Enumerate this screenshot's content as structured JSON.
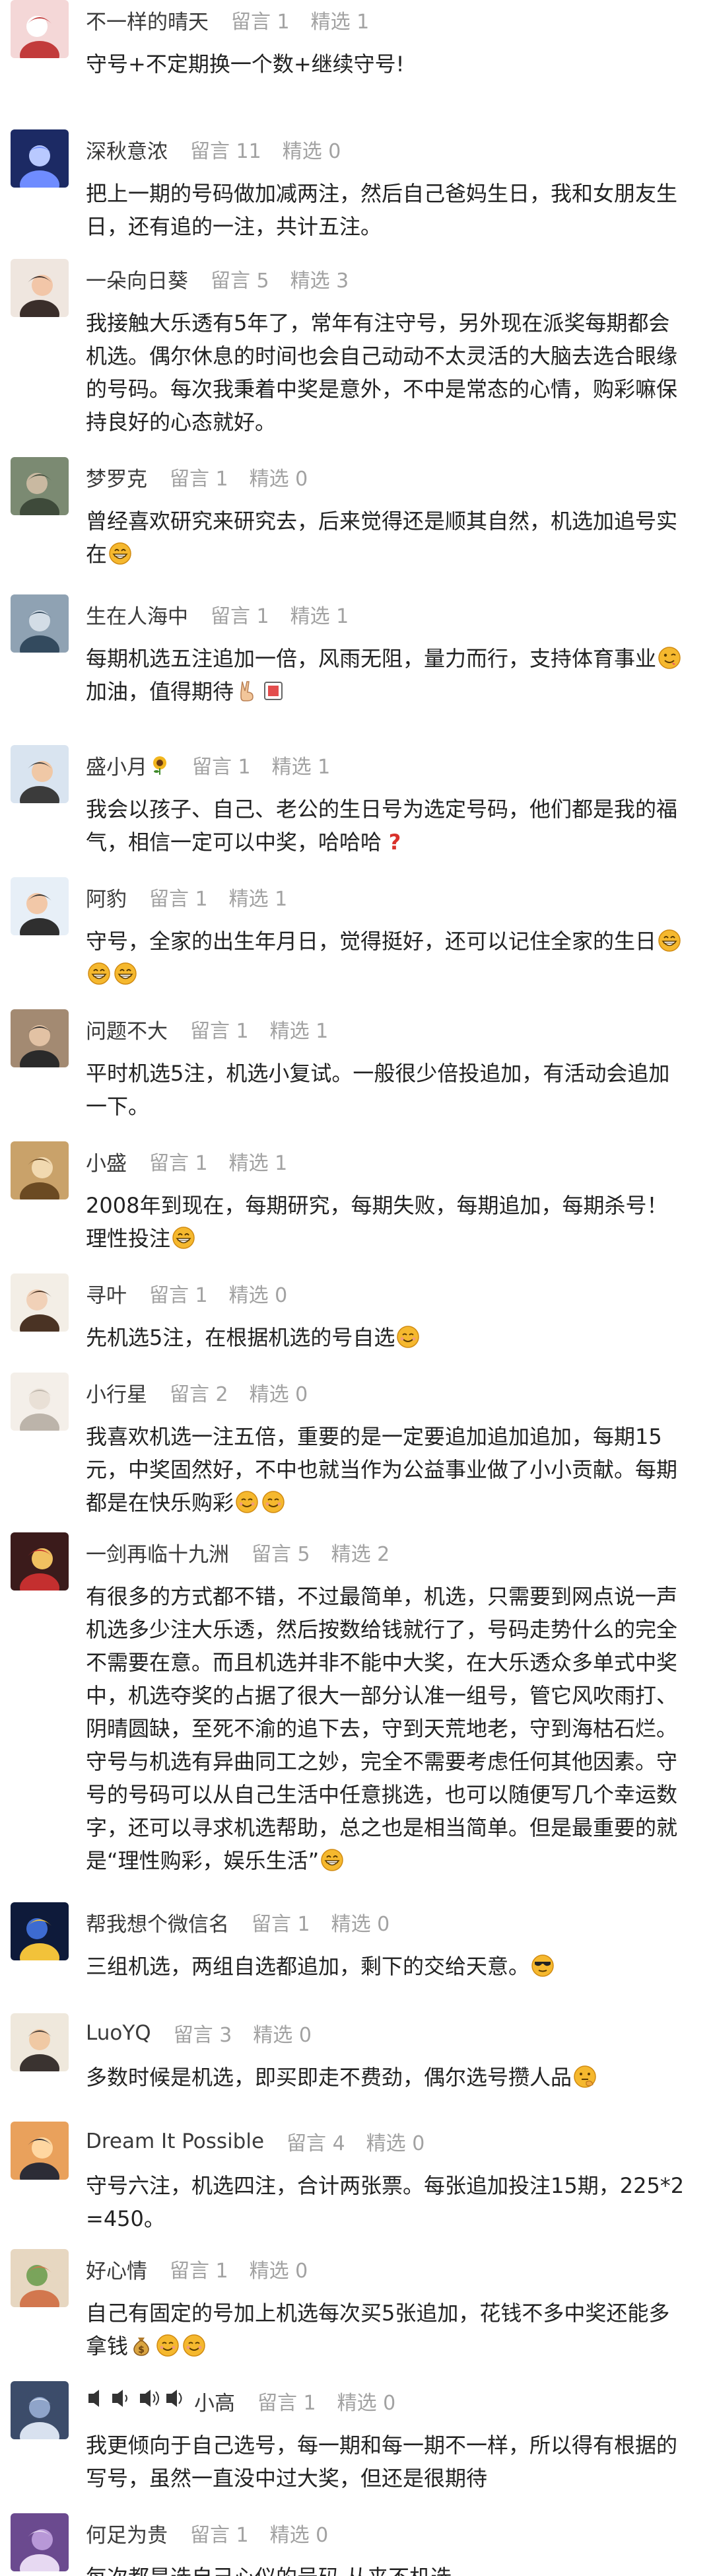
{
  "comments": [
    {
      "user": "不一样的晴天",
      "replies_label": "留言 1",
      "featured_label": "精选 1",
      "body": [
        "守号+不定期换一个数+继续守号!"
      ]
    },
    {
      "user": "深秋意浓",
      "replies_label": "留言 11",
      "featured_label": "精选 0",
      "body": [
        "把上一期的号码做加减两注，然后自己爸妈生日，我和女朋友生日，还有追的一注，共计五注。"
      ]
    },
    {
      "user": "一朵向日葵",
      "replies_label": "留言 5",
      "featured_label": "精选 3",
      "body": [
        "我接触大乐透有5年了，常年有注守号，另外现在派奖每期都会机选。偶尔休息的时间也会自己动动不太灵活的大脑去选合眼缘的号码。每次我秉着中奖是意外，不中是常态的心情，购彩嘛保持良好的心态就好。"
      ]
    },
    {
      "user": "梦罗克",
      "replies_label": "留言 1",
      "featured_label": "精选 0",
      "body": [
        "曾经喜欢研究来研究去，后来觉得还是顺其自然，机选加追号实在"
      ],
      "trail": [
        "grin"
      ]
    },
    {
      "user": "生在人海中",
      "replies_label": "留言 1",
      "featured_label": "精选 1",
      "body": [
        "每期机选五注追加一倍，风雨无阻，量力而行，支持体育事业"
      ],
      "mid": [
        "wink"
      ],
      "body2": "加油，值得期待",
      "trail": [
        "victory",
        "box"
      ]
    },
    {
      "user": "盛小月",
      "replies_label": "留言 1",
      "featured_label": "精选 1",
      "body": [
        "我会以孩子、自己、老公的生日号为选定号码，他们都是我的福气，相信一定可以中奖，哈哈哈"
      ],
      "trail": [
        "question"
      ]
    },
    {
      "user": "阿豹",
      "replies_label": "留言 1",
      "featured_label": "精选 1",
      "body": [
        "守号，全家的出生年月日，觉得挺好，还可以记住全家的生日"
      ],
      "trail": [
        "grin",
        "grin",
        "grin"
      ]
    },
    {
      "user": "问题不大",
      "replies_label": "留言 1",
      "featured_label": "精选 1",
      "body": [
        "平时机选5注，机选小复试。一般很少倍投追加，有活动会追加一下。"
      ]
    },
    {
      "user": "小盛",
      "replies_label": "留言 1",
      "featured_label": "精选 1",
      "body": [
        "2008年到现在，每期研究，每期失败，每期追加，每期杀号！理性投注"
      ],
      "trail": [
        "grin"
      ]
    },
    {
      "user": "寻叶",
      "replies_label": "留言 1",
      "featured_label": "精选 0",
      "body": [
        "先机选5注，在根据机选的号自选"
      ],
      "trail": [
        "smile"
      ]
    },
    {
      "user": "小行星",
      "replies_label": "留言 2",
      "featured_label": "精选 0",
      "body": [
        "我喜欢机选一注五倍，重要的是一定要追加追加追加，每期15元，中奖固然好，不中也就当作为公益事业做了小小贡献。每期都是在快乐购彩"
      ],
      "trail": [
        "smile",
        "smile"
      ]
    },
    {
      "user": "一剑再临十九洲",
      "replies_label": "留言 5",
      "featured_label": "精选 2",
      "body": [
        "有很多的方式都不错，不过最简单，机选，只需要到网点说一声机选多少注大乐透，然后按数给钱就行了，号码走势什么的完全不需要在意。而且机选并非不能中大奖，在大乐透众多单式中奖中，机选夺奖的占据了很大一部分认准一组号，管它风吹雨打、阴晴圆缺，至死不渝的追下去，守到天荒地老，守到海枯石烂。守号与机选有异曲同工之妙，完全不需要考虑任何其他因素。守号的号码可以从自己生活中任意挑选，也可以随便写几个幸运数字，还可以寻求机选帮助，总之也是相当简单。但是最重要的就是“理性购彩，娱乐生活”"
      ],
      "trail": [
        "grin"
      ]
    },
    {
      "user": "帮我想个微信名",
      "replies_label": "留言 1",
      "featured_label": "精选 0",
      "body": [
        "三组机选，两组自选都追加，剩下的交给天意。"
      ],
      "trail": [
        "cool"
      ]
    },
    {
      "user": "LuoYQ",
      "replies_label": "留言 3",
      "featured_label": "精选 0",
      "body": [
        "多数时候是机选，即买即走不费劲，偶尔选号攒人品"
      ],
      "trail": [
        "think"
      ]
    },
    {
      "user": "Dream It Possible",
      "replies_label": "留言 4",
      "featured_label": "精选 0",
      "body": [
        "守号六注，机选四注，合计两张票。每张追加投注15期，225*2=450。"
      ]
    },
    {
      "user": "好心情",
      "replies_label": "留言 1",
      "featured_label": "精选 0",
      "body": [
        "自己有固定的号加上机选每次买5张追加，花钱不多中奖还能多拿钱"
      ],
      "trail": [
        "moneybag",
        "smile",
        "smile"
      ]
    },
    {
      "user": "小高",
      "replies_label": "留言 1",
      "featured_label": "精选 0",
      "body": [
        "我更倾向于自己选号，每一期和每一期不一样，所以得有根据的写号，虽然一直没中过大奖，但还是很期待"
      ]
    },
    {
      "user": "何足为贵",
      "replies_label": "留言 1",
      "featured_label": "精选 0",
      "body": [
        "每次都是选自己心仪的号码 从来不机选"
      ]
    }
  ],
  "icons": {
    "emoji_face": "#f5b82e",
    "accent_red": "#d9312b"
  }
}
